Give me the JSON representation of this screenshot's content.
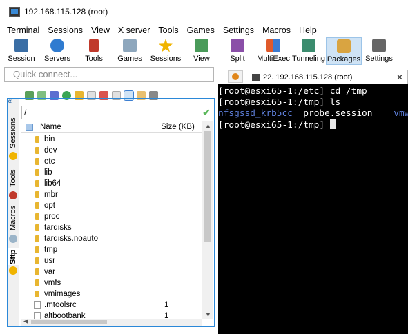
{
  "window": {
    "title": "192.168.115.128 (root)"
  },
  "menu": [
    "Terminal",
    "Sessions",
    "View",
    "X server",
    "Tools",
    "Games",
    "Settings",
    "Macros",
    "Help"
  ],
  "toolbar": [
    {
      "label": "Session",
      "icon": "session-icon",
      "color": "#3a6ea5"
    },
    {
      "label": "Servers",
      "icon": "servers-icon",
      "color": "#2f7bd0"
    },
    {
      "label": "Tools",
      "icon": "tools-icon",
      "color": "#c0392b"
    },
    {
      "label": "Games",
      "icon": "games-icon",
      "color": "#8ea7bd"
    },
    {
      "label": "Sessions",
      "icon": "star-icon",
      "color": "#f0b400"
    },
    {
      "label": "View",
      "icon": "view-icon",
      "color": "#4a9b5a"
    },
    {
      "label": "Split",
      "icon": "split-icon",
      "color": "#8a4fa8"
    },
    {
      "label": "MultiExec",
      "icon": "multiexec-icon",
      "color": "#e05a2b"
    },
    {
      "label": "Tunneling",
      "icon": "tunneling-icon",
      "color": "#3b8c6e"
    },
    {
      "label": "Packages",
      "icon": "packages-icon",
      "color": "#d9a441"
    },
    {
      "label": "Settings",
      "icon": "settings-icon",
      "color": "#666666"
    }
  ],
  "quick_connect": {
    "placeholder": "Quick connect..."
  },
  "tabs": {
    "terminal_tab": "22. 192.168.115.128 (root)"
  },
  "side_tabs": [
    "Sessions",
    "Tools",
    "Macros",
    "Sftp"
  ],
  "sftp": {
    "path": "/",
    "columns": {
      "name": "Name",
      "size": "Size (KB)"
    },
    "rows": [
      {
        "name": "bin",
        "type": "folder",
        "size": ""
      },
      {
        "name": "dev",
        "type": "folder",
        "size": ""
      },
      {
        "name": "etc",
        "type": "folder",
        "size": ""
      },
      {
        "name": "lib",
        "type": "folder",
        "size": ""
      },
      {
        "name": "lib64",
        "type": "folder",
        "size": ""
      },
      {
        "name": "mbr",
        "type": "folder",
        "size": ""
      },
      {
        "name": "opt",
        "type": "folder",
        "size": ""
      },
      {
        "name": "proc",
        "type": "folder",
        "size": ""
      },
      {
        "name": "tardisks",
        "type": "folder",
        "size": ""
      },
      {
        "name": "tardisks.noauto",
        "type": "folder",
        "size": ""
      },
      {
        "name": "tmp",
        "type": "folder",
        "size": ""
      },
      {
        "name": "usr",
        "type": "folder",
        "size": ""
      },
      {
        "name": "var",
        "type": "folder",
        "size": ""
      },
      {
        "name": "vmfs",
        "type": "folder",
        "size": ""
      },
      {
        "name": "vmimages",
        "type": "folder",
        "size": ""
      },
      {
        "name": ".mtoolsrc",
        "type": "file",
        "size": "1"
      },
      {
        "name": "altbootbank",
        "type": "file",
        "size": "1"
      }
    ]
  },
  "terminal": {
    "line1": "[root@esxi65-1:/etc] cd /tmp",
    "line2": "[root@esxi65-1:/tmp] ls",
    "line3_a": "nfsgssd_krb5cc",
    "line3_b": "  probe.session    ",
    "line3_c": "vmw",
    "line4": "[root@esxi65-1:/tmp] "
  }
}
